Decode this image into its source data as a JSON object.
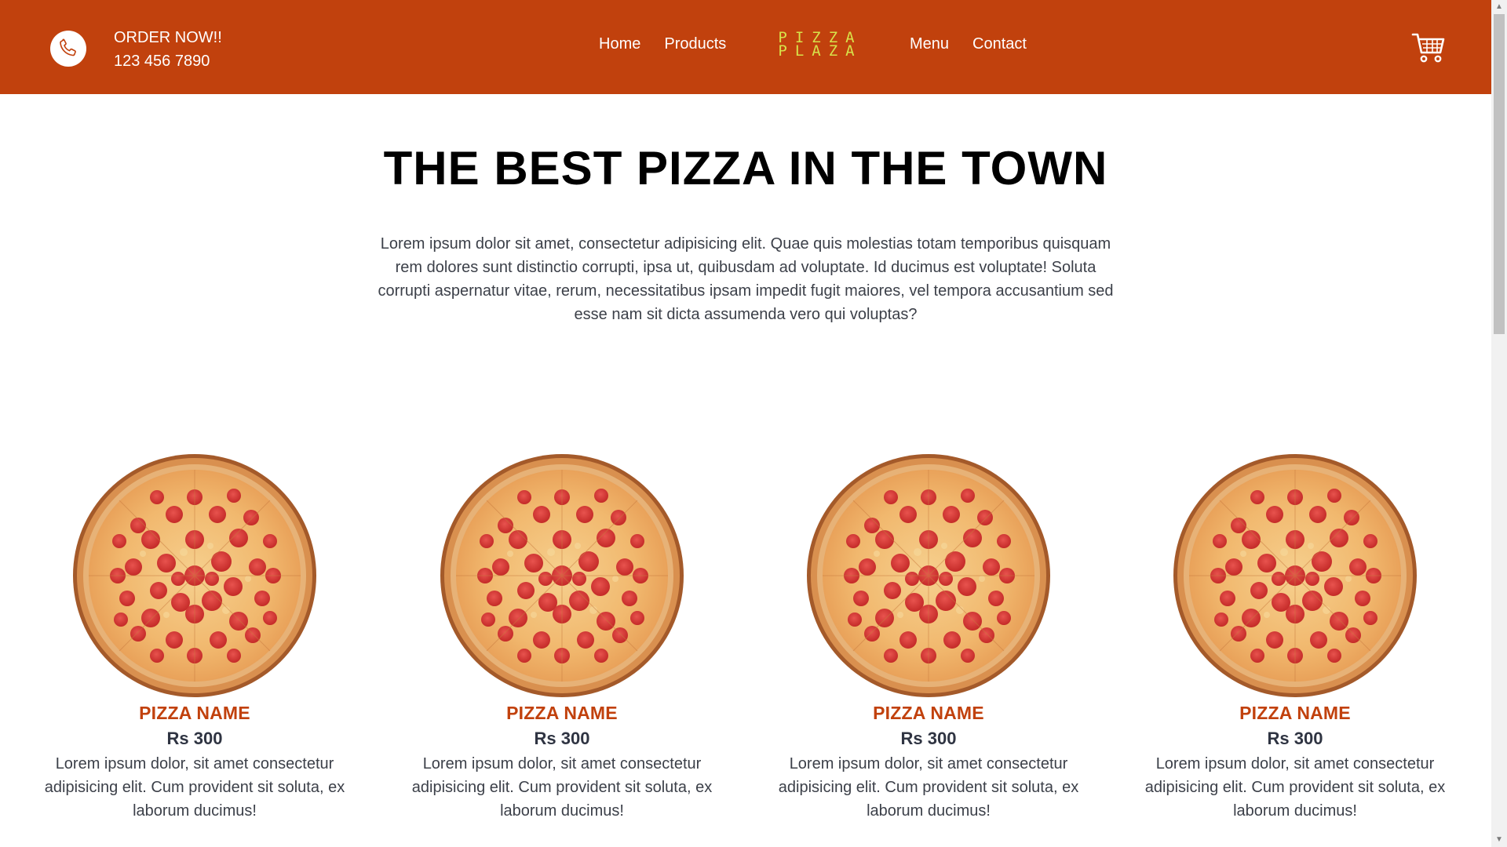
{
  "header": {
    "order_label": "ORDER NOW!!",
    "phone": "123 456 7890",
    "nav_left": [
      "Home",
      "Products"
    ],
    "nav_right": [
      "Menu",
      "Contact"
    ],
    "logo_line1": "PIZZA",
    "logo_line2": "PLAZA",
    "icons": {
      "phone": "phone-icon",
      "cart": "cart-icon"
    }
  },
  "colors": {
    "brand": "#c1410d",
    "logo": "#d7e24a",
    "title": "#000000",
    "body_text": "#3c4049"
  },
  "hero": {
    "title": "THE BEST PIZZA IN THE TOWN",
    "text": "Lorem ipsum dolor sit amet, consectetur adipisicing elit. Quae quis molestias totam temporibus quisquam rem dolores sunt distinctio corrupti, ipsa ut, quibusdam ad voluptate. Id ducimus est voluptate! Soluta corrupti aspernatur vitae, rerum, necessitatibus ipsam impedit fugit maiores, vel tempora accusantium sed esse nam sit dicta assumenda vero qui voluptas?"
  },
  "products": [
    {
      "name": "PIZZA NAME",
      "price": "Rs 300",
      "description": "Lorem ipsum dolor, sit amet consectetur adipisicing elit. Cum provident sit soluta, ex laborum ducimus!"
    },
    {
      "name": "PIZZA NAME",
      "price": "Rs 300",
      "description": "Lorem ipsum dolor, sit amet consectetur adipisicing elit. Cum provident sit soluta, ex laborum ducimus!"
    },
    {
      "name": "PIZZA NAME",
      "price": "Rs 300",
      "description": "Lorem ipsum dolor, sit amet consectetur adipisicing elit. Cum provident sit soluta, ex laborum ducimus!"
    },
    {
      "name": "PIZZA NAME",
      "price": "Rs 300",
      "description": "Lorem ipsum dolor, sit amet consectetur adipisicing elit. Cum provident sit soluta, ex laborum ducimus!"
    }
  ]
}
